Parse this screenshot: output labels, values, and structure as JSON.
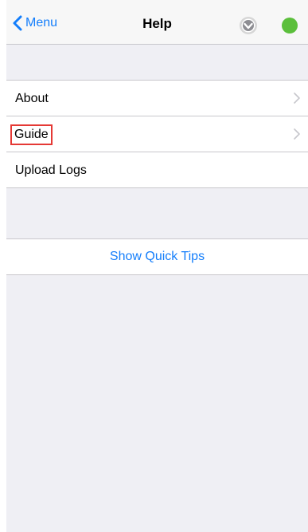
{
  "nav": {
    "back_label": "Menu",
    "title": "Help",
    "status_color": "#5bbf3b",
    "accent_color": "#147efb"
  },
  "help_items": [
    {
      "label": "About",
      "has_chevron": true
    },
    {
      "label": "Guide",
      "has_chevron": true,
      "highlighted": true
    },
    {
      "label": "Upload Logs",
      "has_chevron": false
    }
  ],
  "actions": {
    "quick_tips_label": "Show Quick Tips"
  }
}
